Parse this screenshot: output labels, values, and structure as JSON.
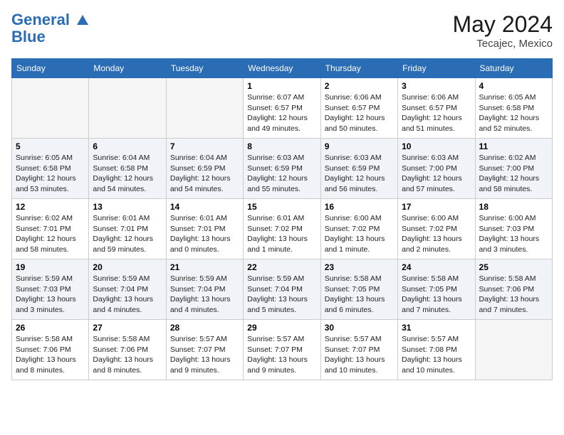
{
  "header": {
    "logo_line1": "General",
    "logo_line2": "Blue",
    "month": "May 2024",
    "location": "Tecajec, Mexico"
  },
  "days_of_week": [
    "Sunday",
    "Monday",
    "Tuesday",
    "Wednesday",
    "Thursday",
    "Friday",
    "Saturday"
  ],
  "weeks": [
    [
      {
        "day": "",
        "empty": true
      },
      {
        "day": "",
        "empty": true
      },
      {
        "day": "",
        "empty": true
      },
      {
        "day": "1",
        "sunrise": "6:07 AM",
        "sunset": "6:57 PM",
        "daylight": "12 hours and 49 minutes."
      },
      {
        "day": "2",
        "sunrise": "6:06 AM",
        "sunset": "6:57 PM",
        "daylight": "12 hours and 50 minutes."
      },
      {
        "day": "3",
        "sunrise": "6:06 AM",
        "sunset": "6:57 PM",
        "daylight": "12 hours and 51 minutes."
      },
      {
        "day": "4",
        "sunrise": "6:05 AM",
        "sunset": "6:58 PM",
        "daylight": "12 hours and 52 minutes."
      }
    ],
    [
      {
        "day": "5",
        "sunrise": "6:05 AM",
        "sunset": "6:58 PM",
        "daylight": "12 hours and 53 minutes."
      },
      {
        "day": "6",
        "sunrise": "6:04 AM",
        "sunset": "6:58 PM",
        "daylight": "12 hours and 54 minutes."
      },
      {
        "day": "7",
        "sunrise": "6:04 AM",
        "sunset": "6:59 PM",
        "daylight": "12 hours and 54 minutes."
      },
      {
        "day": "8",
        "sunrise": "6:03 AM",
        "sunset": "6:59 PM",
        "daylight": "12 hours and 55 minutes."
      },
      {
        "day": "9",
        "sunrise": "6:03 AM",
        "sunset": "6:59 PM",
        "daylight": "12 hours and 56 minutes."
      },
      {
        "day": "10",
        "sunrise": "6:03 AM",
        "sunset": "7:00 PM",
        "daylight": "12 hours and 57 minutes."
      },
      {
        "day": "11",
        "sunrise": "6:02 AM",
        "sunset": "7:00 PM",
        "daylight": "12 hours and 58 minutes."
      }
    ],
    [
      {
        "day": "12",
        "sunrise": "6:02 AM",
        "sunset": "7:01 PM",
        "daylight": "12 hours and 58 minutes."
      },
      {
        "day": "13",
        "sunrise": "6:01 AM",
        "sunset": "7:01 PM",
        "daylight": "12 hours and 59 minutes."
      },
      {
        "day": "14",
        "sunrise": "6:01 AM",
        "sunset": "7:01 PM",
        "daylight": "13 hours and 0 minutes."
      },
      {
        "day": "15",
        "sunrise": "6:01 AM",
        "sunset": "7:02 PM",
        "daylight": "13 hours and 1 minute."
      },
      {
        "day": "16",
        "sunrise": "6:00 AM",
        "sunset": "7:02 PM",
        "daylight": "13 hours and 1 minute."
      },
      {
        "day": "17",
        "sunrise": "6:00 AM",
        "sunset": "7:02 PM",
        "daylight": "13 hours and 2 minutes."
      },
      {
        "day": "18",
        "sunrise": "6:00 AM",
        "sunset": "7:03 PM",
        "daylight": "13 hours and 3 minutes."
      }
    ],
    [
      {
        "day": "19",
        "sunrise": "5:59 AM",
        "sunset": "7:03 PM",
        "daylight": "13 hours and 3 minutes."
      },
      {
        "day": "20",
        "sunrise": "5:59 AM",
        "sunset": "7:04 PM",
        "daylight": "13 hours and 4 minutes."
      },
      {
        "day": "21",
        "sunrise": "5:59 AM",
        "sunset": "7:04 PM",
        "daylight": "13 hours and 4 minutes."
      },
      {
        "day": "22",
        "sunrise": "5:59 AM",
        "sunset": "7:04 PM",
        "daylight": "13 hours and 5 minutes."
      },
      {
        "day": "23",
        "sunrise": "5:58 AM",
        "sunset": "7:05 PM",
        "daylight": "13 hours and 6 minutes."
      },
      {
        "day": "24",
        "sunrise": "5:58 AM",
        "sunset": "7:05 PM",
        "daylight": "13 hours and 7 minutes."
      },
      {
        "day": "25",
        "sunrise": "5:58 AM",
        "sunset": "7:06 PM",
        "daylight": "13 hours and 7 minutes."
      }
    ],
    [
      {
        "day": "26",
        "sunrise": "5:58 AM",
        "sunset": "7:06 PM",
        "daylight": "13 hours and 8 minutes."
      },
      {
        "day": "27",
        "sunrise": "5:58 AM",
        "sunset": "7:06 PM",
        "daylight": "13 hours and 8 minutes."
      },
      {
        "day": "28",
        "sunrise": "5:57 AM",
        "sunset": "7:07 PM",
        "daylight": "13 hours and 9 minutes."
      },
      {
        "day": "29",
        "sunrise": "5:57 AM",
        "sunset": "7:07 PM",
        "daylight": "13 hours and 9 minutes."
      },
      {
        "day": "30",
        "sunrise": "5:57 AM",
        "sunset": "7:07 PM",
        "daylight": "13 hours and 10 minutes."
      },
      {
        "day": "31",
        "sunrise": "5:57 AM",
        "sunset": "7:08 PM",
        "daylight": "13 hours and 10 minutes."
      },
      {
        "day": "",
        "empty": true
      }
    ]
  ]
}
